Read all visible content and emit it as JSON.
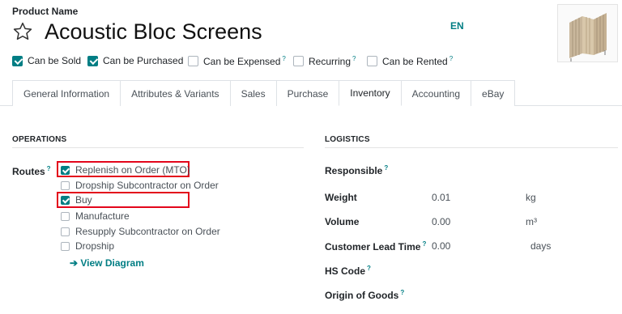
{
  "header": {
    "product_name_label": "Product Name",
    "title": "Acoustic Bloc Screens",
    "language": "EN"
  },
  "flags": [
    {
      "label": "Can be Sold",
      "checked": true,
      "help": ""
    },
    {
      "label": "Can be Purchased",
      "checked": true,
      "help": ""
    },
    {
      "label": "Can be Expensed",
      "checked": false,
      "help": "?"
    },
    {
      "label": "Recurring",
      "checked": false,
      "help": "?"
    },
    {
      "label": "Can be Rented",
      "checked": false,
      "help": "?"
    }
  ],
  "tabs": [
    "General Information",
    "Attributes & Variants",
    "Sales",
    "Purchase",
    "Inventory",
    "Accounting",
    "eBay"
  ],
  "active_tab": "Inventory",
  "operations": {
    "title": "OPERATIONS",
    "routes_label": "Routes",
    "routes_help": "?",
    "routes": [
      {
        "label": "Replenish on Order (MTO)",
        "checked": true
      },
      {
        "label": "Dropship Subcontractor on Order",
        "checked": false
      },
      {
        "label": "Buy",
        "checked": true
      },
      {
        "label": "Manufacture",
        "checked": false
      },
      {
        "label": "Resupply Subcontractor on Order",
        "checked": false
      },
      {
        "label": "Dropship",
        "checked": false
      }
    ],
    "view_diagram": "➔ View Diagram"
  },
  "logistics": {
    "title": "LOGISTICS",
    "responsible_label": "Responsible",
    "weight_label": "Weight",
    "weight_value": "0.01",
    "weight_unit": "kg",
    "volume_label": "Volume",
    "volume_value": "0.00",
    "volume_unit": "m³",
    "lead_time_label": "Customer Lead Time",
    "lead_time_value": "0.00",
    "lead_time_unit": "days",
    "hs_code_label": "HS Code",
    "origin_label": "Origin of Goods",
    "help": "?"
  },
  "colors": {
    "accent": "#017e84",
    "highlight": "#e3061b"
  }
}
